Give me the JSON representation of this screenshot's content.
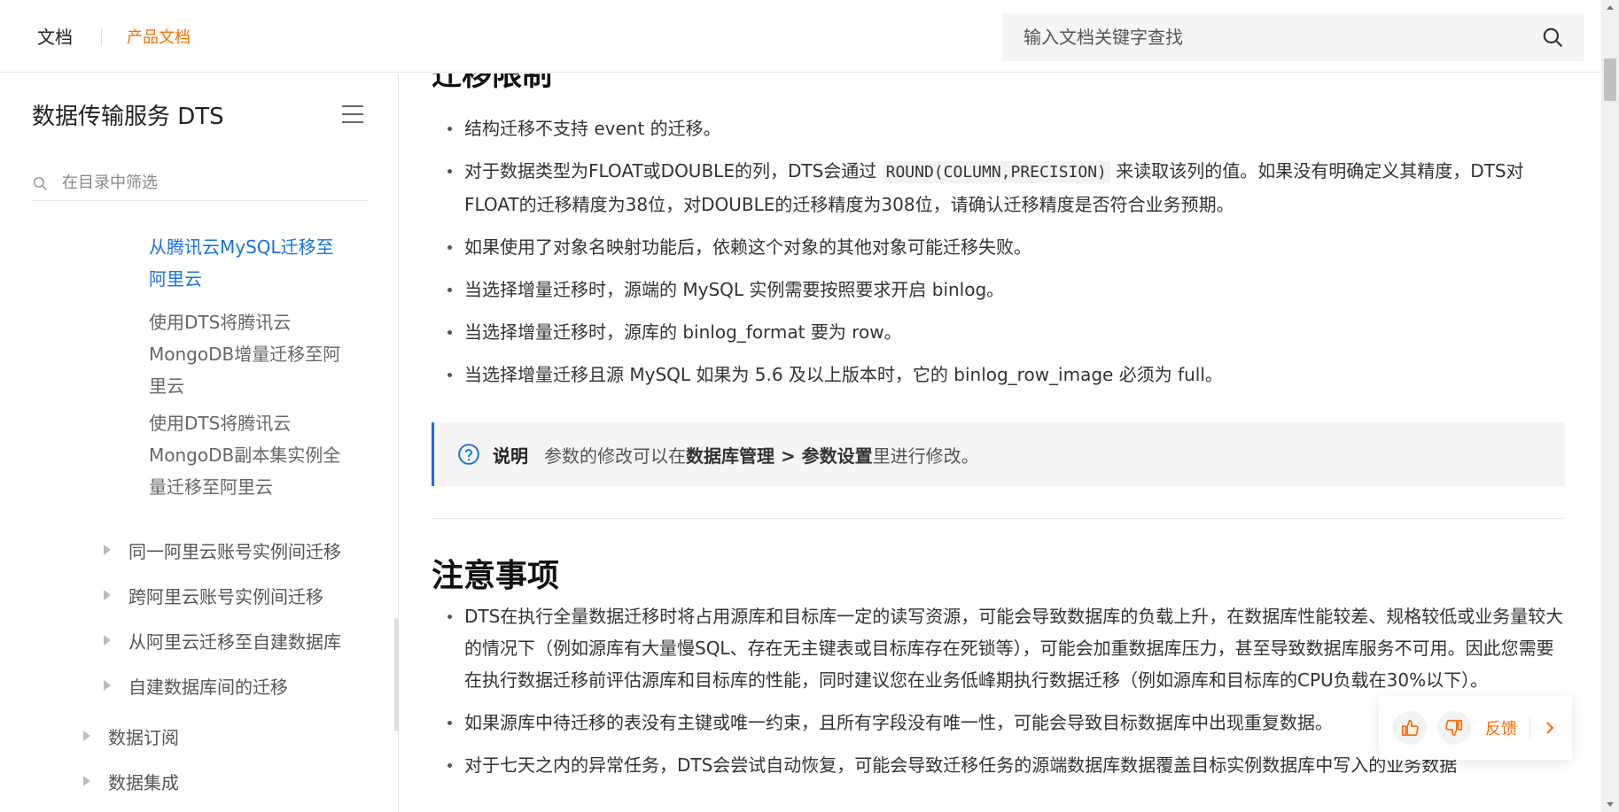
{
  "header": {
    "brand": "文档",
    "product": "产品文档",
    "search_placeholder": "输入文档关键字查找"
  },
  "sidebar": {
    "title": "数据传输服务 DTS",
    "filter_placeholder": "在目录中筛选",
    "items": [
      {
        "label": "从腾讯云MySQL迁移至阿里云",
        "lines": [
          "从腾讯云MySQL迁移至",
          "阿里云"
        ],
        "active": true
      },
      {
        "label": "使用DTS将腾讯云MongoDB增量迁移至阿里云",
        "lines": [
          "使用DTS将腾讯云",
          "MongoDB增量迁移至阿",
          "里云"
        ],
        "active": false
      },
      {
        "label": "使用DTS将腾讯云MongoDB副本集实例全量迁移至阿里云",
        "lines": [
          "使用DTS将腾讯云",
          "MongoDB副本集实例全",
          "量迁移至阿里云"
        ],
        "active": false
      }
    ],
    "groups": [
      {
        "label": "同一阿里云账号实例间迁移"
      },
      {
        "label": "跨阿里云账号实例间迁移"
      },
      {
        "label": "从阿里云迁移至自建数据库"
      },
      {
        "label": "自建数据库间的迁移"
      }
    ],
    "top_groups": [
      {
        "label": "数据订阅"
      },
      {
        "label": "数据集成"
      }
    ]
  },
  "content": {
    "partial_heading": "迁移限制",
    "limits": [
      {
        "text": "结构迁移不支持 event 的迁移。"
      },
      {
        "pre": "对于数据类型为FLOAT或DOUBLE的列，DTS会通过 ",
        "code": "ROUND(COLUMN,PRECISION)",
        "post": " 来读取该列的值。如果没有明确定义其精度，DTS对FLOAT的迁移精度为38位，对DOUBLE的迁移精度为308位，请确认迁移精度是否符合业务预期。"
      },
      {
        "text": "如果使用了对象名映射功能后，依赖这个对象的其他对象可能迁移失败。"
      },
      {
        "text": "当选择增量迁移时，源端的 MySQL 实例需要按照要求开启 binlog。"
      },
      {
        "text": "当选择增量迁移时，源库的 binlog_format 要为 row。"
      },
      {
        "text": "当选择增量迁移且源 MySQL 如果为 5.6 及以上版本时，它的 binlog_row_image 必须为 full。"
      }
    ],
    "note": {
      "label": "说明",
      "pre": "参数的修改可以在",
      "bold": "数据库管理 > 参数设置",
      "post": "里进行修改。"
    },
    "section_heading": "注意事项",
    "notes": [
      {
        "text": "DTS在执行全量数据迁移时将占用源库和目标库一定的读写资源，可能会导致数据库的负载上升，在数据库性能较差、规格较低或业务量较大的情况下（例如源库有大量慢SQL、存在无主键表或目标库存在死锁等），可能会加重数据库压力，甚至导致数据库服务不可用。因此您需要在执行数据迁移前评估源库和目标库的性能，同时建议您在业务低峰期执行数据迁移（例如源库和目标库的CPU负载在30%以下）。"
      },
      {
        "text": "如果源库中待迁移的表没有主键或唯一约束，且所有字段没有唯一性，可能会导致目标数据库中出现重复数据。"
      },
      {
        "text": "对于七天之内的异常任务，DTS会尝试自动恢复，可能会导致迁移任务的源端数据库数据覆盖目标实例数据库中写入的业务数据"
      }
    ]
  },
  "feedback": {
    "label": "反馈"
  },
  "colors": {
    "accent": "#ff6a00",
    "link": "#1a6fe0"
  }
}
